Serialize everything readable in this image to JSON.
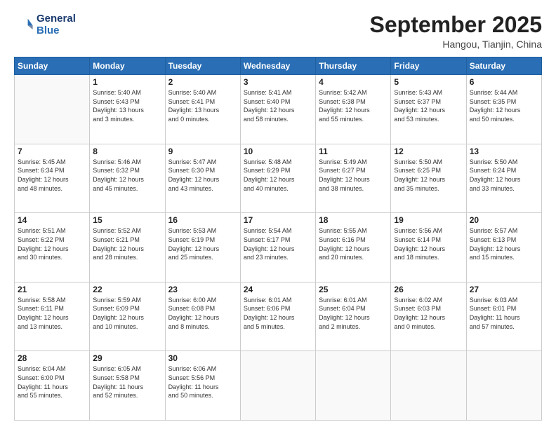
{
  "logo": {
    "line1": "General",
    "line2": "Blue"
  },
  "header": {
    "month": "September 2025",
    "location": "Hangou, Tianjin, China"
  },
  "weekdays": [
    "Sunday",
    "Monday",
    "Tuesday",
    "Wednesday",
    "Thursday",
    "Friday",
    "Saturday"
  ],
  "weeks": [
    [
      {
        "day": "",
        "info": ""
      },
      {
        "day": "1",
        "info": "Sunrise: 5:40 AM\nSunset: 6:43 PM\nDaylight: 13 hours\nand 3 minutes."
      },
      {
        "day": "2",
        "info": "Sunrise: 5:40 AM\nSunset: 6:41 PM\nDaylight: 13 hours\nand 0 minutes."
      },
      {
        "day": "3",
        "info": "Sunrise: 5:41 AM\nSunset: 6:40 PM\nDaylight: 12 hours\nand 58 minutes."
      },
      {
        "day": "4",
        "info": "Sunrise: 5:42 AM\nSunset: 6:38 PM\nDaylight: 12 hours\nand 55 minutes."
      },
      {
        "day": "5",
        "info": "Sunrise: 5:43 AM\nSunset: 6:37 PM\nDaylight: 12 hours\nand 53 minutes."
      },
      {
        "day": "6",
        "info": "Sunrise: 5:44 AM\nSunset: 6:35 PM\nDaylight: 12 hours\nand 50 minutes."
      }
    ],
    [
      {
        "day": "7",
        "info": "Sunrise: 5:45 AM\nSunset: 6:34 PM\nDaylight: 12 hours\nand 48 minutes."
      },
      {
        "day": "8",
        "info": "Sunrise: 5:46 AM\nSunset: 6:32 PM\nDaylight: 12 hours\nand 45 minutes."
      },
      {
        "day": "9",
        "info": "Sunrise: 5:47 AM\nSunset: 6:30 PM\nDaylight: 12 hours\nand 43 minutes."
      },
      {
        "day": "10",
        "info": "Sunrise: 5:48 AM\nSunset: 6:29 PM\nDaylight: 12 hours\nand 40 minutes."
      },
      {
        "day": "11",
        "info": "Sunrise: 5:49 AM\nSunset: 6:27 PM\nDaylight: 12 hours\nand 38 minutes."
      },
      {
        "day": "12",
        "info": "Sunrise: 5:50 AM\nSunset: 6:25 PM\nDaylight: 12 hours\nand 35 minutes."
      },
      {
        "day": "13",
        "info": "Sunrise: 5:50 AM\nSunset: 6:24 PM\nDaylight: 12 hours\nand 33 minutes."
      }
    ],
    [
      {
        "day": "14",
        "info": "Sunrise: 5:51 AM\nSunset: 6:22 PM\nDaylight: 12 hours\nand 30 minutes."
      },
      {
        "day": "15",
        "info": "Sunrise: 5:52 AM\nSunset: 6:21 PM\nDaylight: 12 hours\nand 28 minutes."
      },
      {
        "day": "16",
        "info": "Sunrise: 5:53 AM\nSunset: 6:19 PM\nDaylight: 12 hours\nand 25 minutes."
      },
      {
        "day": "17",
        "info": "Sunrise: 5:54 AM\nSunset: 6:17 PM\nDaylight: 12 hours\nand 23 minutes."
      },
      {
        "day": "18",
        "info": "Sunrise: 5:55 AM\nSunset: 6:16 PM\nDaylight: 12 hours\nand 20 minutes."
      },
      {
        "day": "19",
        "info": "Sunrise: 5:56 AM\nSunset: 6:14 PM\nDaylight: 12 hours\nand 18 minutes."
      },
      {
        "day": "20",
        "info": "Sunrise: 5:57 AM\nSunset: 6:13 PM\nDaylight: 12 hours\nand 15 minutes."
      }
    ],
    [
      {
        "day": "21",
        "info": "Sunrise: 5:58 AM\nSunset: 6:11 PM\nDaylight: 12 hours\nand 13 minutes."
      },
      {
        "day": "22",
        "info": "Sunrise: 5:59 AM\nSunset: 6:09 PM\nDaylight: 12 hours\nand 10 minutes."
      },
      {
        "day": "23",
        "info": "Sunrise: 6:00 AM\nSunset: 6:08 PM\nDaylight: 12 hours\nand 8 minutes."
      },
      {
        "day": "24",
        "info": "Sunrise: 6:01 AM\nSunset: 6:06 PM\nDaylight: 12 hours\nand 5 minutes."
      },
      {
        "day": "25",
        "info": "Sunrise: 6:01 AM\nSunset: 6:04 PM\nDaylight: 12 hours\nand 2 minutes."
      },
      {
        "day": "26",
        "info": "Sunrise: 6:02 AM\nSunset: 6:03 PM\nDaylight: 12 hours\nand 0 minutes."
      },
      {
        "day": "27",
        "info": "Sunrise: 6:03 AM\nSunset: 6:01 PM\nDaylight: 11 hours\nand 57 minutes."
      }
    ],
    [
      {
        "day": "28",
        "info": "Sunrise: 6:04 AM\nSunset: 6:00 PM\nDaylight: 11 hours\nand 55 minutes."
      },
      {
        "day": "29",
        "info": "Sunrise: 6:05 AM\nSunset: 5:58 PM\nDaylight: 11 hours\nand 52 minutes."
      },
      {
        "day": "30",
        "info": "Sunrise: 6:06 AM\nSunset: 5:56 PM\nDaylight: 11 hours\nand 50 minutes."
      },
      {
        "day": "",
        "info": ""
      },
      {
        "day": "",
        "info": ""
      },
      {
        "day": "",
        "info": ""
      },
      {
        "day": "",
        "info": ""
      }
    ]
  ]
}
